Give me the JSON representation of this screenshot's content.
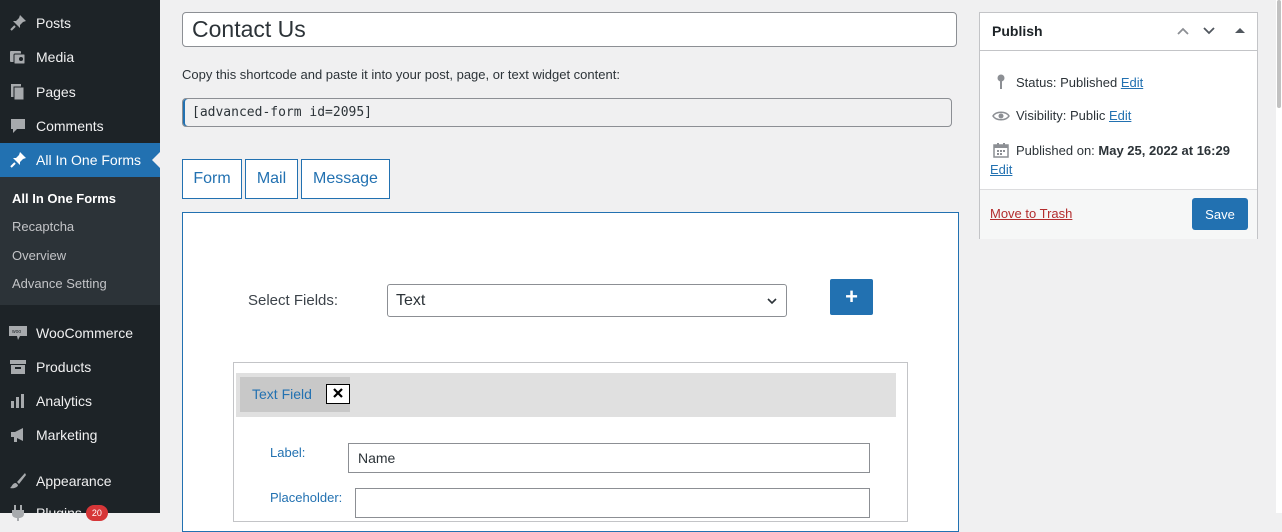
{
  "sidebar": {
    "items": [
      {
        "label": "Posts",
        "icon": "pin-icon"
      },
      {
        "label": "Media",
        "icon": "media-icon"
      },
      {
        "label": "Pages",
        "icon": "pages-icon"
      },
      {
        "label": "Comments",
        "icon": "comment-icon"
      },
      {
        "label": "All In One Forms",
        "icon": "pin-icon",
        "current": true
      },
      {
        "label": "WooCommerce",
        "icon": "woo-icon"
      },
      {
        "label": "Products",
        "icon": "archive-icon"
      },
      {
        "label": "Analytics",
        "icon": "chart-icon"
      },
      {
        "label": "Marketing",
        "icon": "megaphone-icon"
      },
      {
        "label": "Appearance",
        "icon": "brush-icon"
      },
      {
        "label": "Plugins",
        "icon": "plug-icon",
        "badge": "20"
      }
    ],
    "submenu": [
      "All In One Forms",
      "Recaptcha",
      "Overview",
      "Advance Setting"
    ],
    "accent": "#2271b1"
  },
  "editor": {
    "title": "Contact Us",
    "shortcode_instruction": "Copy this shortcode and paste it into your post, page, or text widget content:",
    "shortcode": "[advanced-form id=2095]",
    "tabs": [
      "Form",
      "Mail",
      "Message"
    ]
  },
  "form_builder": {
    "select_label": "Select Fields:",
    "select_value": "Text",
    "add_button": "+",
    "field": {
      "tab_label": "Text Field",
      "remove_icon": "close-icon",
      "label_caption": "Label:",
      "label_value": "Name",
      "placeholder_caption": "Placeholder:",
      "placeholder_value": ""
    }
  },
  "publish": {
    "title": "Publish",
    "status_label": "Status: Published",
    "visibility_label": "Visibility: Public",
    "published_on_label": "Published on:",
    "published_on_date": "May 25, 2022 at 16:29",
    "edit_link": "Edit",
    "trash_link": "Move to Trash",
    "save_button": "Save"
  }
}
